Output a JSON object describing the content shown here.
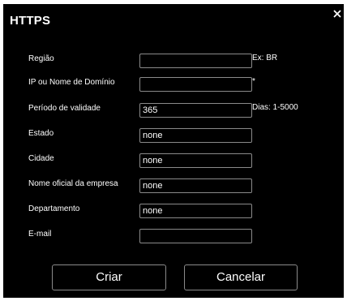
{
  "dialog": {
    "title": "HTTPS",
    "close_icon": "close-icon"
  },
  "form": {
    "fields": [
      {
        "label": "Região",
        "value": "",
        "hint": "Ex: BR"
      },
      {
        "label": "IP ou Nome de Domínio",
        "value": "",
        "hint": "*"
      },
      {
        "label": "Período de validade",
        "value": "365",
        "hint": "Dias: 1-5000"
      },
      {
        "label": "Estado",
        "value": "none",
        "hint": ""
      },
      {
        "label": "Cidade",
        "value": "none",
        "hint": ""
      },
      {
        "label": "Nome oficial da empresa",
        "value": "none",
        "hint": ""
      },
      {
        "label": "Departamento",
        "value": "none",
        "hint": ""
      },
      {
        "label": "E-mail",
        "value": "",
        "hint": ""
      }
    ]
  },
  "buttons": {
    "create_label": "Criar",
    "cancel_label": "Cancelar"
  },
  "colors": {
    "background": "#000000",
    "text": "#ffffff",
    "border": "#8a8a8a"
  }
}
